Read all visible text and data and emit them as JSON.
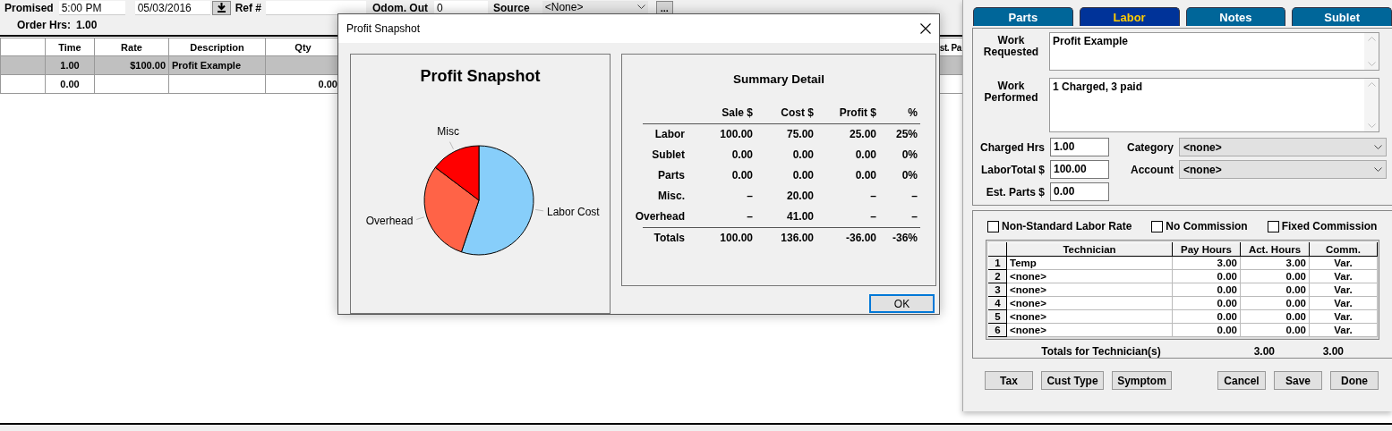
{
  "header": {
    "promised_label": "Promised",
    "promised_time": "5:00 PM",
    "promised_date": "05/03/2016",
    "ref_label": "Ref #",
    "odom_label": "Odom. Out",
    "odom_value": "0",
    "source_label": "Source",
    "source_value": "<None>",
    "browse_button": "..."
  },
  "order_hrs": {
    "label": "Order Hrs:",
    "value": "1.00"
  },
  "lines_table": {
    "columns": [
      "Time",
      "Rate",
      "Description",
      "Qty",
      "st. Pa"
    ],
    "rows": [
      {
        "selected": true,
        "time": "1.00",
        "rate": "$100.00",
        "description": "Profit Example"
      },
      {
        "selected": false,
        "time": "0.00",
        "qty": "0.00"
      }
    ]
  },
  "dialog": {
    "title": "Profit Snapshot",
    "chart_title": "Profit Snapshot",
    "chart_data": {
      "type": "pie",
      "categories": [
        "Labor Cost",
        "Overhead",
        "Misc"
      ],
      "values": [
        55.2,
        30.1,
        14.7
      ],
      "colors": [
        "#87cefa",
        "#ff6347",
        "#ff0000"
      ]
    },
    "summary": {
      "title": "Summary Detail",
      "columns": [
        "Sale $",
        "Cost $",
        "Profit $",
        "%"
      ],
      "rows": [
        {
          "label": "Labor",
          "values": [
            "100.00",
            "75.00",
            "25.00",
            "25%"
          ]
        },
        {
          "label": "Sublet",
          "values": [
            "0.00",
            "0.00",
            "0.00",
            "0%"
          ]
        },
        {
          "label": "Parts",
          "values": [
            "0.00",
            "0.00",
            "0.00",
            "0%"
          ]
        },
        {
          "label": "Misc.",
          "values": [
            "–",
            "20.00",
            "–",
            "–"
          ]
        },
        {
          "label": "Overhead",
          "values": [
            "–",
            "41.00",
            "–",
            "–"
          ]
        }
      ],
      "totals": {
        "label": "Totals",
        "values": [
          "100.00",
          "136.00",
          "-36.00",
          "-36%"
        ]
      }
    },
    "ok_button": "OK"
  },
  "labor_panel": {
    "tabs": [
      {
        "label": "Parts",
        "selected": false
      },
      {
        "label": "Labor",
        "selected": true
      },
      {
        "label": "Notes",
        "selected": false
      },
      {
        "label": "Sublet",
        "selected": false
      }
    ],
    "work_requested": {
      "label": "Work Requested",
      "value": "Profit Example"
    },
    "work_performed": {
      "label": "Work Performed",
      "value": "1 Charged, 3 paid"
    },
    "fields": [
      {
        "label": "Charged Hrs",
        "value": "1.00"
      },
      {
        "label": "LaborTotal $",
        "value": "100.00"
      },
      {
        "label": "Est. Parts $",
        "value": "0.00"
      }
    ],
    "dropdowns": [
      {
        "label": "Category",
        "value": "<none>"
      },
      {
        "label": "Account",
        "value": "<none>"
      }
    ],
    "checkboxes": [
      {
        "label": "Non-Standard Labor Rate",
        "checked": false
      },
      {
        "label": "No Commission",
        "checked": false
      },
      {
        "label": "Fixed Commission",
        "checked": false
      }
    ],
    "technicians": {
      "columns": [
        "Technician",
        "Pay Hours",
        "Act. Hours",
        "Comm."
      ],
      "rows": [
        {
          "number": "1",
          "technician": "Temp",
          "pay_hours": "3.00",
          "act_hours": "3.00",
          "comm": "Var."
        },
        {
          "number": "2",
          "technician": "<none>",
          "pay_hours": "0.00",
          "act_hours": "0.00",
          "comm": "Var."
        },
        {
          "number": "3",
          "technician": "<none>",
          "pay_hours": "0.00",
          "act_hours": "0.00",
          "comm": "Var."
        },
        {
          "number": "4",
          "technician": "<none>",
          "pay_hours": "0.00",
          "act_hours": "0.00",
          "comm": "Var."
        },
        {
          "number": "5",
          "technician": "<none>",
          "pay_hours": "0.00",
          "act_hours": "0.00",
          "comm": "Var."
        },
        {
          "number": "6",
          "technician": "<none>",
          "pay_hours": "0.00",
          "act_hours": "0.00",
          "comm": "Var."
        }
      ]
    },
    "totals": {
      "label": "Totals for Technician(s)",
      "pay_hours": "3.00",
      "act_hours": "3.00"
    },
    "left_buttons": [
      "Tax",
      "Cust Type",
      "Symptom"
    ],
    "right_buttons": [
      "Cancel",
      "Save",
      "Done"
    ]
  }
}
